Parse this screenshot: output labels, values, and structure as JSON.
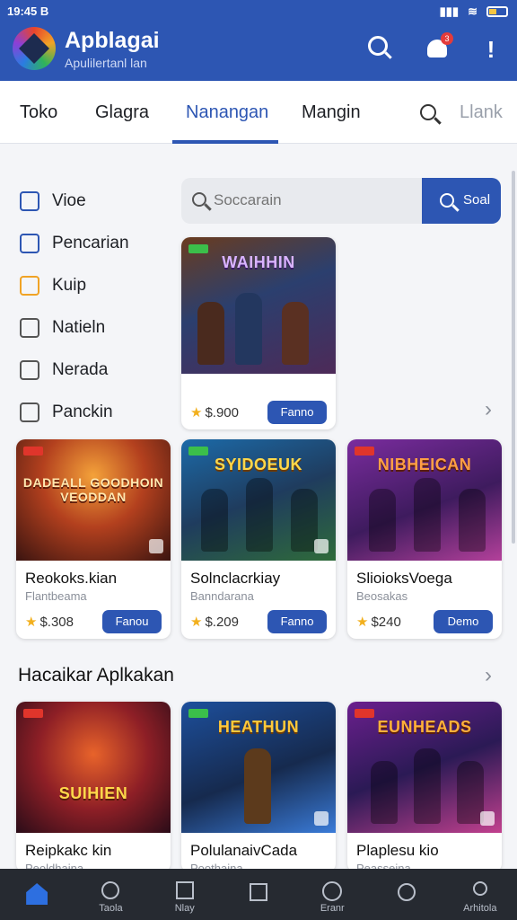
{
  "status_bar": {
    "time": "19:45 B"
  },
  "header": {
    "title": "Apblagai",
    "subtitle": "Apulilertanl lan",
    "notification_count": "3"
  },
  "tabs": [
    {
      "label": "Toko"
    },
    {
      "label": "Glagra"
    },
    {
      "label": "Nanangan"
    },
    {
      "label": "Mangin"
    }
  ],
  "tabs_extra": "Llank",
  "side_menu": [
    {
      "label": "Vioe",
      "icon": "grid-icon"
    },
    {
      "label": "Pencarian",
      "icon": "home-icon"
    },
    {
      "label": "Kuip",
      "icon": "folder-icon"
    },
    {
      "label": "Natieln",
      "icon": "tools-icon"
    },
    {
      "label": "Nerada",
      "icon": "list-icon"
    },
    {
      "label": "Panckin",
      "icon": "document-icon"
    }
  ],
  "search": {
    "placeholder": "Soccarain",
    "button_label": "Soal"
  },
  "featured": {
    "art_title": "WAIHHIN",
    "price": "$.900",
    "button": "Fanno"
  },
  "row1": [
    {
      "art_title": "DADEALL GOODHOIN VEODDAN",
      "name": "Reokoks.kian",
      "sub": "Flantbeama",
      "price": "$.308",
      "button": "Fanou"
    },
    {
      "art_title": "SYIDOEUK",
      "name": "Solnclacrkiay",
      "sub": "Banndarana",
      "price": "$.209",
      "button": "Fanno"
    },
    {
      "art_title": "NIBHEICAN",
      "name": "SlioioksVoega",
      "sub": "Beosakas",
      "price": "$240",
      "button": "Demo"
    }
  ],
  "section": {
    "title": "Hacaikar Aplkakan"
  },
  "row2": [
    {
      "art_title": "SUIHIEN",
      "name": "Reipkakc kin",
      "sub": "Peoldhaina"
    },
    {
      "art_title": "HEATHUN",
      "name": "PolulanaivCada",
      "sub": "Poothaina"
    },
    {
      "art_title": "EUNHEADS",
      "name": "Plaplesu kio",
      "sub": "Peasseina"
    }
  ],
  "bottom_nav": [
    {
      "label": ""
    },
    {
      "label": "Taola"
    },
    {
      "label": "Nlay"
    },
    {
      "label": ""
    },
    {
      "label": "Eranr"
    },
    {
      "label": ""
    },
    {
      "label": "Arhitola"
    }
  ],
  "colors": {
    "primary": "#2d56b3",
    "nav_bg": "#262a31",
    "star": "#f2b01e"
  }
}
